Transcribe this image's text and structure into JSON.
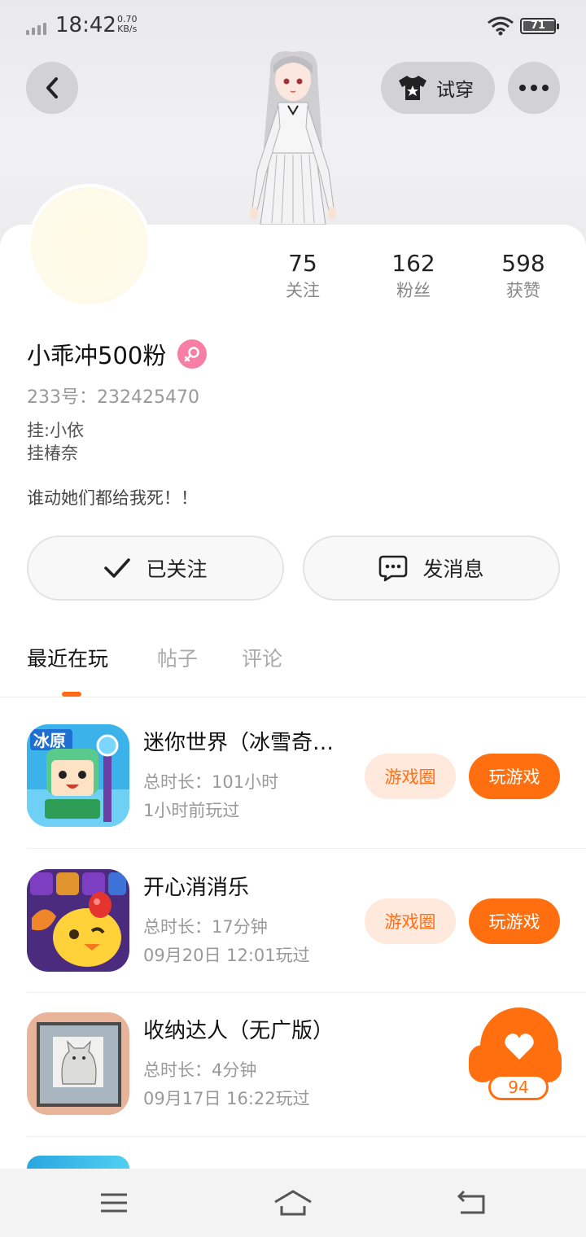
{
  "status_bar": {
    "time": "18:42",
    "speed_value": "0.70",
    "speed_unit": "KB/s",
    "battery": "71",
    "icons": [
      "signal-icon",
      "wifi-icon",
      "battery-icon"
    ]
  },
  "header": {
    "tryon_label": "试穿",
    "icons": [
      "back-arrow-icon",
      "tshirt-icon",
      "more-icon"
    ]
  },
  "profile": {
    "stats": [
      {
        "num": "75",
        "label": "关注"
      },
      {
        "num": "162",
        "label": "粉丝"
      },
      {
        "num": "598",
        "label": "获赞"
      }
    ],
    "username": "小乖冲500粉",
    "gender_icon": "female-icon",
    "uid": "233号：232425470",
    "bio_lines": [
      "挂:小依",
      "挂椿奈"
    ],
    "signature": "谁动她们都给我死！！"
  },
  "actions": {
    "follow_label": "已关注",
    "message_label": "发消息"
  },
  "tabs": [
    {
      "label": "最近在玩",
      "active": true
    },
    {
      "label": "帖子",
      "active": false
    },
    {
      "label": "评论",
      "active": false
    }
  ],
  "games": [
    {
      "title": "迷你世界（冰雪奇缘版）",
      "duration": "总时长：101小时",
      "last_played": "1小时前玩过",
      "circle_label": "游戏圈",
      "play_label": "玩游戏",
      "icon": "mini-world-game-icon"
    },
    {
      "title": "开心消消乐",
      "duration": "总时长：17分钟",
      "last_played": "09月20日 12:01玩过",
      "circle_label": "游戏圈",
      "play_label": "玩游戏",
      "icon": "happy-elimination-game-icon"
    },
    {
      "title": "收纳达人（无广版）",
      "duration": "总时长：4分钟",
      "last_played": "09月17日 16:22玩过",
      "icon": "storage-master-game-icon"
    }
  ],
  "like_float": {
    "count": "94",
    "icon": "heart-icon"
  },
  "navbar": {
    "icons": [
      "menu-icon",
      "home-icon",
      "back-icon"
    ]
  },
  "colors": {
    "accent": "#ff6f0f",
    "accent_light": "#ffe9dc",
    "female_badge": "#f77fa3"
  }
}
